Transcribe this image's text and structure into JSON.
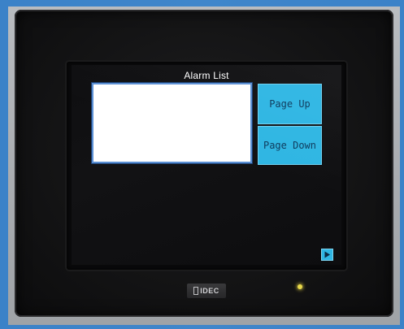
{
  "screen": {
    "title": "Alarm List",
    "alarm_list": {
      "items": []
    },
    "buttons": {
      "page_up": "Page Up",
      "page_down": "Page Down",
      "next_icon": "play-right-icon"
    }
  },
  "device": {
    "brand": "IDEC",
    "led_state": "on"
  },
  "colors": {
    "button_fill": "#2fb6e3",
    "list_border": "#5a8fd4",
    "led": "#e8d84a",
    "bezel": "#141415"
  }
}
